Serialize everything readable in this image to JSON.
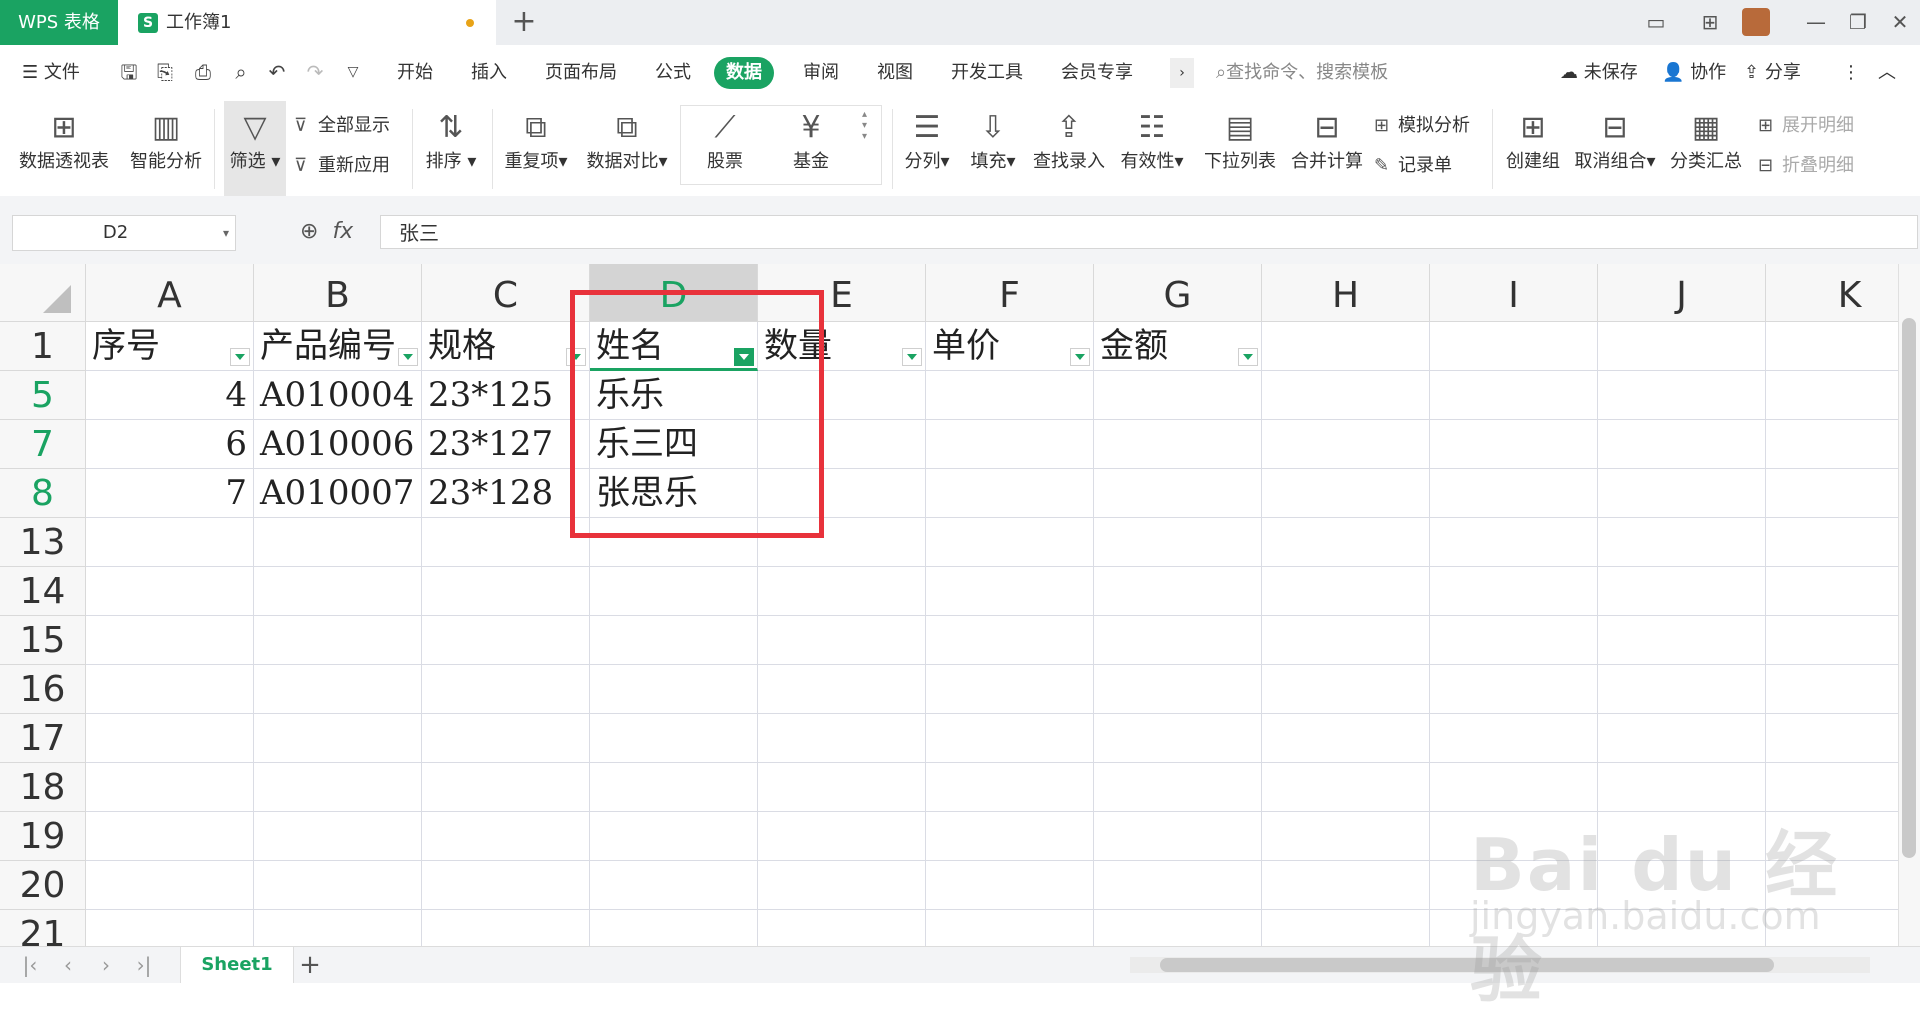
{
  "app_tab": "WPS 表格",
  "document_tab": {
    "name": "工作簿1"
  },
  "menu": {
    "file": "文件",
    "tabs": [
      "开始",
      "插入",
      "页面布局",
      "公式",
      "数据",
      "审阅",
      "视图",
      "开发工具",
      "会员专享"
    ],
    "active_tab": "数据",
    "search_placeholder": "查找命令、搜索模板",
    "unsaved": "未保存",
    "collaborate": "协作",
    "share": "分享"
  },
  "ribbon": {
    "pivot": "数据透视表",
    "smart_analysis": "智能分析",
    "filter": "筛选",
    "show_all": "全部显示",
    "reapply": "重新应用",
    "sort": "排序",
    "duplicates": "重复项",
    "compare": "数据对比",
    "stock": "股票",
    "fund": "基金",
    "split": "分列",
    "fill": "填充",
    "lookup": "查找录入",
    "validity": "有效性",
    "dropdown": "下拉列表",
    "consolidate": "合并计算",
    "simulate": "模拟分析",
    "record": "记录单",
    "group": "创建组",
    "ungroup": "取消组合",
    "subtotal": "分类汇总",
    "expand": "展开明细",
    "collapse": "折叠明细"
  },
  "formula_bar": {
    "name_box": "D2",
    "content": "张三"
  },
  "grid": {
    "columns": [
      "A",
      "B",
      "C",
      "D",
      "E",
      "F",
      "G",
      "H",
      "I",
      "J",
      "K"
    ],
    "selected_column": "D",
    "headers": {
      "A": "序号",
      "B": "产品编号",
      "C": "规格",
      "D": "姓名",
      "E": "数量",
      "F": "单价",
      "G": "金额"
    },
    "rows": [
      {
        "row": "1",
        "cells": {}
      },
      {
        "row": "5",
        "cells": {
          "A": "4",
          "B": "A010004",
          "C": "23*125",
          "D": "乐乐"
        }
      },
      {
        "row": "7",
        "cells": {
          "A": "6",
          "B": "A010006",
          "C": "23*127",
          "D": "乐三四"
        }
      },
      {
        "row": "8",
        "cells": {
          "A": "7",
          "B": "A010007",
          "C": "23*128",
          "D": "张思乐"
        }
      },
      {
        "row": "13",
        "cells": {}
      },
      {
        "row": "14",
        "cells": {}
      },
      {
        "row": "15",
        "cells": {}
      },
      {
        "row": "16",
        "cells": {}
      },
      {
        "row": "17",
        "cells": {}
      },
      {
        "row": "18",
        "cells": {}
      },
      {
        "row": "19",
        "cells": {}
      },
      {
        "row": "20",
        "cells": {}
      },
      {
        "row": "21",
        "cells": {}
      }
    ],
    "filtered_rows": [
      "5",
      "7",
      "8"
    ],
    "filter_active_column": "D"
  },
  "sheets": {
    "active": "Sheet1"
  },
  "watermark": {
    "main": "Bai du 经验",
    "sub": "jingyan.baidu.com"
  },
  "colors": {
    "accent": "#1aa362",
    "highlight": "#e8323b"
  }
}
